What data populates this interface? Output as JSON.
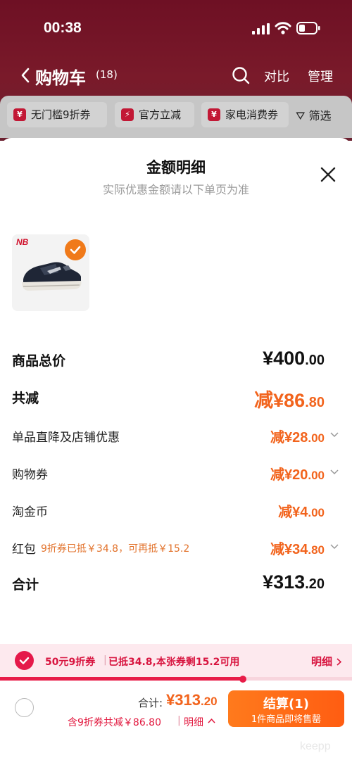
{
  "status_bar": {
    "time": "00:38"
  },
  "nav": {
    "title": "购物车",
    "count": "(18)",
    "compare": "对比",
    "manage": "管理"
  },
  "filter_chips": [
    {
      "label": "无门槛9折券",
      "icon": "yen-coupon-icon"
    },
    {
      "label": "官方立减",
      "icon": "lightning-icon"
    },
    {
      "label": "家电消费券",
      "icon": "yen-coupon-icon"
    }
  ],
  "filter_label": "筛选",
  "sheet": {
    "title": "金额明细",
    "subtitle": "实际优惠金额请以下单页为准",
    "product": {
      "brand_logo": "NB",
      "selected": true
    },
    "rows": {
      "total_price": {
        "label": "商品总价",
        "currency": "¥",
        "int": "400",
        "dec": ".00"
      },
      "total_discount": {
        "label": "共减",
        "prefix": "减¥",
        "int": "86",
        "dec": ".80"
      },
      "direct_discount": {
        "label": "单品直降及店铺优惠",
        "prefix": "减¥",
        "int": "28",
        "dec": ".00"
      },
      "shopping_coupon": {
        "label": "购物券",
        "prefix": "减¥",
        "int": "20",
        "dec": ".00"
      },
      "taojinbi": {
        "label": "淘金币",
        "prefix": "减¥",
        "int": "4",
        "dec": ".00"
      },
      "red_packet": {
        "label": "红包",
        "note": "9折券已抵￥34.8，可再抵￥15.2",
        "prefix": "减¥",
        "int": "34",
        "dec": ".80"
      },
      "sum": {
        "label": "合计",
        "currency": "¥",
        "int": "313",
        "dec": ".20"
      }
    }
  },
  "coupon_bar": {
    "name": "50元9折券",
    "separator": "|",
    "info": "已抵34.8,本张券剩15.2可用",
    "detail": "明细",
    "progress": 0.69
  },
  "bottom": {
    "total_label": "合计:",
    "total_currency": "¥",
    "total_int": "313",
    "total_dec": ".20",
    "saved": "含9折券共减￥86.80",
    "separator": "|",
    "detail": "明细",
    "checkout_label": "结算(1)",
    "checkout_sub": "1件商品即将售罄"
  },
  "watermark": "keepp",
  "colors": {
    "accent_orange": "#f2641d",
    "accent_red": "#e5194a",
    "header_bg": "#6e1024"
  }
}
